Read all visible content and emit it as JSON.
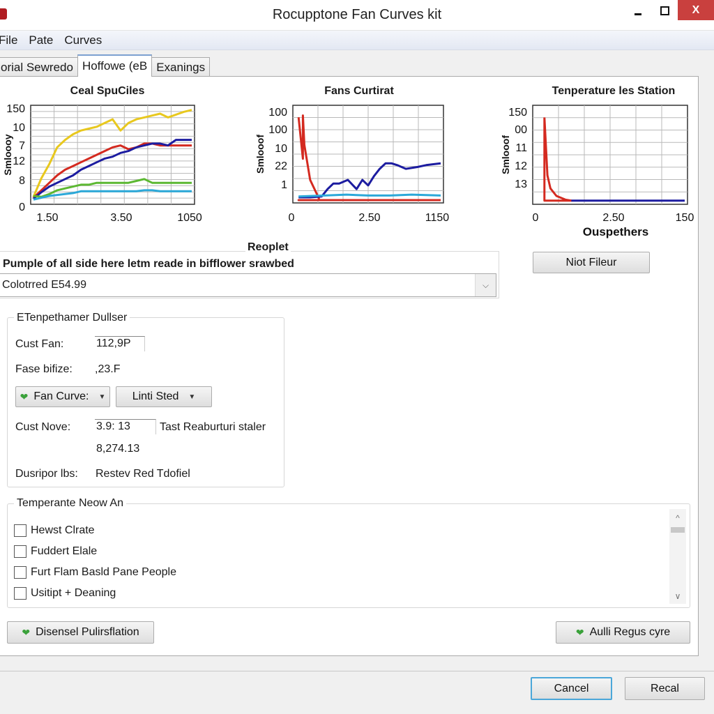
{
  "window": {
    "title": "Rocupptone Fan Curves kit",
    "controls": {
      "minimize": "–",
      "maximize": "□",
      "close": "X"
    }
  },
  "menu": [
    "File",
    "Pate",
    "Curves"
  ],
  "tabs": [
    {
      "label": "orial Sewredo",
      "active": false
    },
    {
      "label": "Hoffowe (eB",
      "active": true
    },
    {
      "label": "Exanings",
      "active": false
    }
  ],
  "charts": {
    "chart1": {
      "title": "Ceal SpuCiles",
      "ylabel": "Smloooy",
      "yticks": [
        "150",
        "10",
        "7",
        "12",
        "8",
        "0"
      ],
      "xticks": [
        "1.50",
        "3.50",
        "1050"
      ]
    },
    "chart2": {
      "title": "Fans Curtirat",
      "ylabel": "Smlooof",
      "yticks": [
        "100",
        "100",
        "10",
        "22",
        "1"
      ],
      "xticks": [
        "0",
        "2.50",
        "1150"
      ]
    },
    "chart3": {
      "title": "Tenperature les Station",
      "ylabel": "Smlooof",
      "xlabel": "Ouspethers",
      "yticks": [
        "150",
        "00",
        "11",
        "12",
        "13"
      ],
      "xticks": [
        "0",
        "2.50",
        "150"
      ]
    }
  },
  "chart_data": [
    {
      "type": "line",
      "title": "Ceal SpuCiles",
      "xlabel": "",
      "ylabel": "Smloooy",
      "x_tick_labels": [
        "1.50",
        "3.50",
        "1050"
      ],
      "y_tick_labels": [
        "150",
        "10",
        "7",
        "12",
        "8",
        "0"
      ],
      "x": [
        0,
        0.05,
        0.1,
        0.15,
        0.2,
        0.25,
        0.3,
        0.35,
        0.4,
        0.45,
        0.5,
        0.55,
        0.6,
        0.65,
        0.7,
        0.75,
        0.8,
        0.85,
        0.9,
        0.95,
        1.0
      ],
      "xlim": [
        0,
        1
      ],
      "ylim": [
        0,
        100
      ],
      "grid": true,
      "series": [
        {
          "name": "yellow",
          "color": "#e8c81e",
          "values": [
            5,
            25,
            40,
            58,
            66,
            72,
            76,
            78,
            80,
            84,
            88,
            76,
            84,
            88,
            90,
            92,
            94,
            90,
            93,
            96,
            98
          ]
        },
        {
          "name": "red",
          "color": "#d42a20",
          "values": [
            4,
            12,
            20,
            28,
            34,
            38,
            42,
            46,
            50,
            54,
            58,
            60,
            56,
            58,
            62,
            62,
            60,
            60,
            60,
            60,
            60
          ]
        },
        {
          "name": "blue",
          "color": "#1c1ca0",
          "values": [
            3,
            10,
            16,
            20,
            24,
            28,
            34,
            38,
            42,
            46,
            48,
            52,
            54,
            58,
            60,
            62,
            62,
            60,
            66,
            66,
            66
          ]
        },
        {
          "name": "green",
          "color": "#5cb832",
          "values": [
            6,
            5,
            8,
            12,
            14,
            16,
            18,
            18,
            20,
            20,
            20,
            20,
            20,
            22,
            24,
            20,
            20,
            20,
            20,
            20,
            20
          ]
        },
        {
          "name": "cyan",
          "color": "#2ba8d8",
          "values": [
            2,
            4,
            6,
            7,
            8,
            9,
            11,
            11,
            11,
            11,
            11,
            11,
            11,
            11,
            12,
            12,
            11,
            11,
            11,
            11,
            11
          ]
        }
      ]
    },
    {
      "type": "line",
      "title": "Fans Curtirat",
      "xlabel": "",
      "ylabel": "Smlooof",
      "x_tick_labels": [
        "0",
        "2.50",
        "1150"
      ],
      "y_tick_labels": [
        "100",
        "100",
        "10",
        "22",
        "1"
      ],
      "xlim": [
        0,
        1
      ],
      "ylim": [
        0,
        100
      ],
      "grid": true,
      "series": [
        {
          "name": "red",
          "color": "#d42a20",
          "x": [
            0.02,
            0.05,
            0.05,
            0.06,
            0.1,
            0.16,
            0.16,
            0.02,
            0.02,
            1.0
          ],
          "values": [
            90,
            45,
            92,
            60,
            22,
            2,
            0,
            0,
            0,
            0
          ]
        },
        {
          "name": "blue",
          "color": "#1c1ca0",
          "x": [
            0.02,
            0.1,
            0.18,
            0.22,
            0.26,
            0.3,
            0.36,
            0.42,
            0.46,
            0.5,
            0.54,
            0.58,
            0.62,
            0.66,
            0.7,
            0.76,
            0.84,
            0.9,
            1.0
          ],
          "values": [
            3,
            3,
            4,
            12,
            18,
            18,
            22,
            12,
            22,
            16,
            26,
            34,
            40,
            40,
            38,
            34,
            36,
            38,
            40
          ]
        },
        {
          "name": "cyan",
          "color": "#2ba8d8",
          "x": [
            0.02,
            0.2,
            0.35,
            0.5,
            0.65,
            0.8,
            1.0
          ],
          "values": [
            4,
            5,
            6,
            5,
            5,
            6,
            5
          ]
        }
      ]
    },
    {
      "type": "line",
      "title": "Tenperature les Station",
      "xlabel": "Ouspethers",
      "ylabel": "Smlooof",
      "x_tick_labels": [
        "0",
        "2.50",
        "150"
      ],
      "y_tick_labels": [
        "150",
        "00",
        "11",
        "12",
        "13"
      ],
      "xlim": [
        0,
        1
      ],
      "ylim": [
        0,
        100
      ],
      "grid": true,
      "series": [
        {
          "name": "red",
          "color": "#d42a20",
          "x": [
            0.06,
            0.08,
            0.1,
            0.14,
            0.2,
            0.24,
            0.06,
            0.06
          ],
          "values": [
            90,
            28,
            14,
            6,
            2,
            1,
            1,
            90
          ]
        },
        {
          "name": "blue",
          "color": "#1c1ca0",
          "x": [
            0.24,
            1.0
          ],
          "values": [
            1,
            1
          ]
        }
      ]
    }
  ],
  "reoplet": {
    "legend": "Reoplet",
    "description": "Pumple of all side here letm reade in bifflower srawbed",
    "combo_value": "Colotrred E54.99",
    "button": "Niot Fileur"
  },
  "group1": {
    "legend": "ETenpethamer Dullser",
    "cust_fan_label": "Cust Fan:",
    "cust_fan_value": "112,9P",
    "fase_label": "Fase bifize:",
    "fase_value": ",23.F",
    "fan_curve_button": "Fan Curve:",
    "linti_button": "Linti Sted",
    "cust_nove_label": "Cust Nove:",
    "cust_nove_value": "3.9: 13",
    "cust_nove_note": "Tast Reaburturi staler",
    "cust_nove_value2": "8,274.13",
    "dusripor_label": "Dusripor lbs:",
    "dusripor_value": "Restev Red Tdofiel"
  },
  "group2": {
    "legend": "Temperante Neow An",
    "items": [
      {
        "label": "Hewst Clrate",
        "checked": false
      },
      {
        "label": "Fuddert Elale",
        "checked": false
      },
      {
        "label": "Furt Flam Basld Pane People",
        "checked": false
      },
      {
        "label": "Usitipt + Deaning",
        "checked": false
      }
    ]
  },
  "actions": {
    "left_button": "Disensel Pulirsflation",
    "right_button": "Aulli Regus cyre"
  },
  "footer": {
    "cancel": "Cancel",
    "recal": "Recal"
  }
}
